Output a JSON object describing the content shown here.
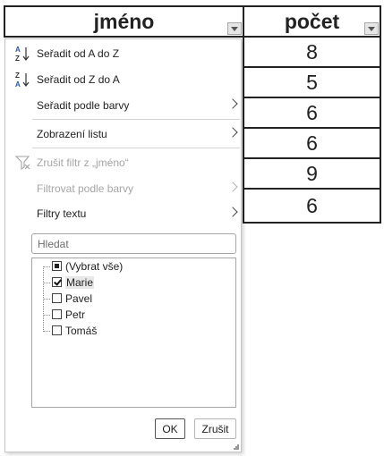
{
  "sheet": {
    "headers": {
      "name": "jméno",
      "count": "počet"
    },
    "counts": [
      "8",
      "5",
      "6",
      "6",
      "9",
      "6"
    ]
  },
  "filter_menu": {
    "items": [
      {
        "label": "Seřadit od A do Z",
        "icon": "sort-az-icon",
        "enabled": true,
        "submenu": false
      },
      {
        "label": "Seřadit od Z do A",
        "icon": "sort-za-icon",
        "enabled": true,
        "submenu": false
      },
      {
        "label": "Seřadit podle barvy",
        "enabled": true,
        "submenu": true
      },
      {
        "label": "Zobrazení listu",
        "enabled": true,
        "submenu": true
      },
      {
        "label": "Zrušit filtr z „jméno“",
        "icon": "clear-filter-icon",
        "enabled": false,
        "submenu": false
      },
      {
        "label": "Filtrovat podle barvy",
        "enabled": false,
        "submenu": true
      },
      {
        "label": "Filtry textu",
        "enabled": true,
        "submenu": true
      }
    ],
    "search": {
      "placeholder": "Hledat",
      "value": ""
    },
    "values": [
      {
        "label": "(Vybrat vše)",
        "state": "partial"
      },
      {
        "label": "Marie",
        "state": "checked"
      },
      {
        "label": "Pavel",
        "state": "unchecked"
      },
      {
        "label": "Petr",
        "state": "unchecked"
      },
      {
        "label": "Tomáš",
        "state": "unchecked"
      }
    ],
    "ok_label": "OK",
    "cancel_label": "Zrušit"
  }
}
